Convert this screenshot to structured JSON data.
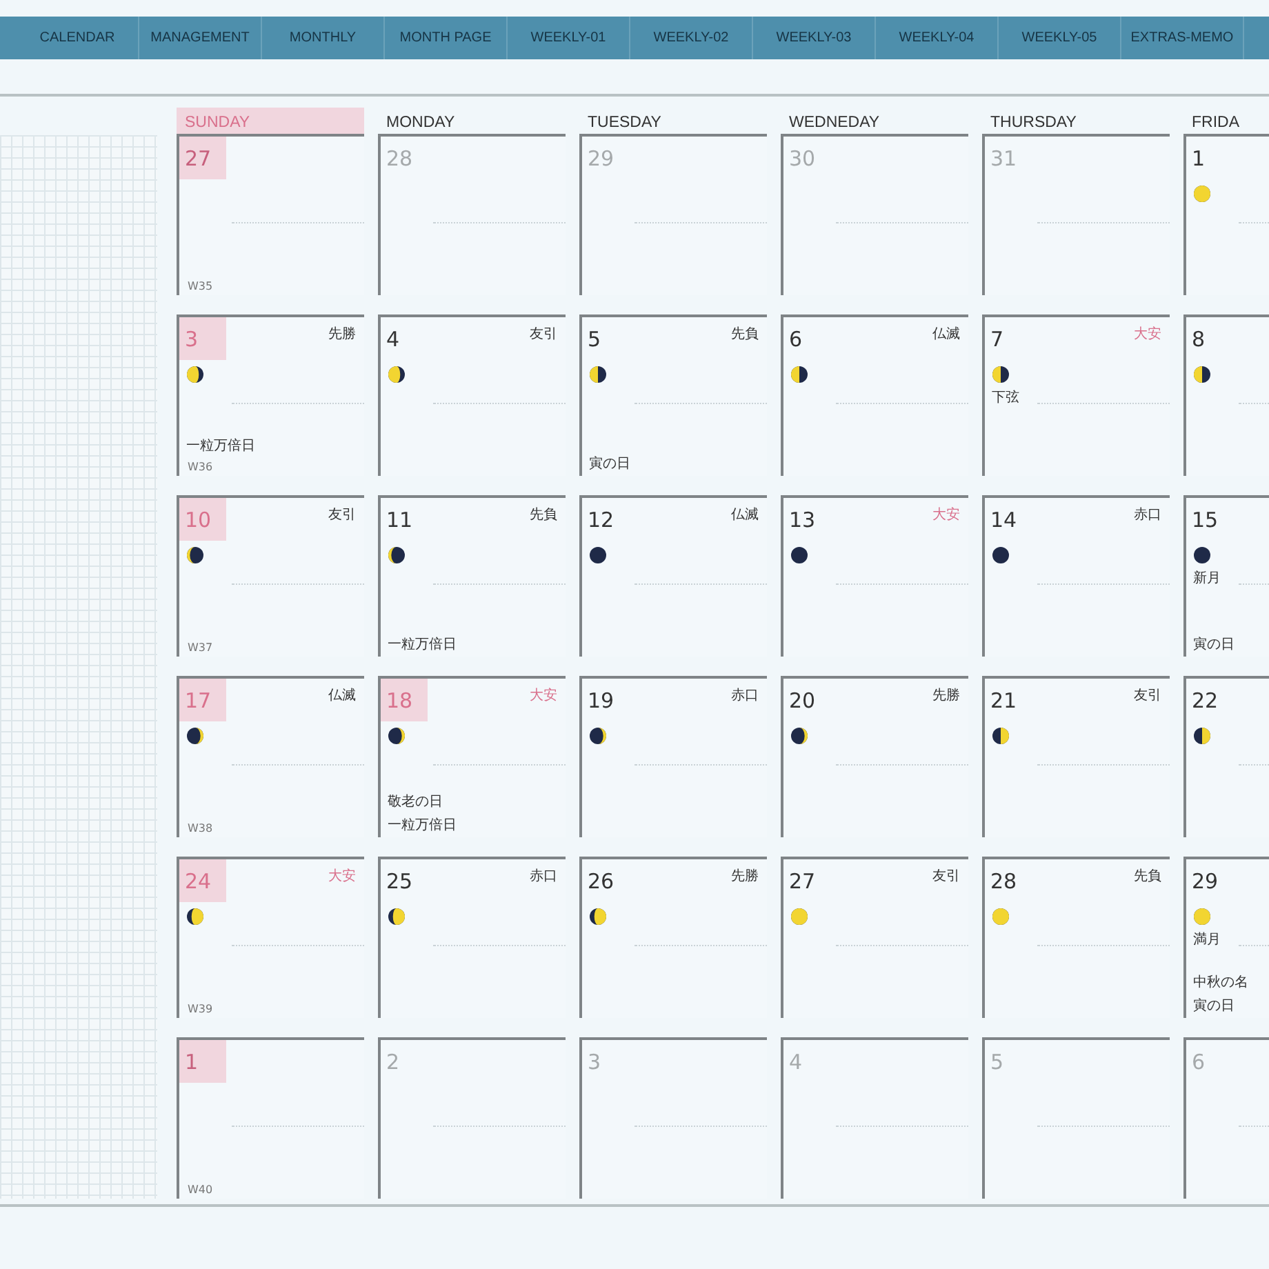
{
  "tabs": [
    {
      "label": "CALENDAR",
      "selected": false
    },
    {
      "label": "MANAGEMENT",
      "selected": false
    },
    {
      "label": "MONTHLY",
      "selected": false
    },
    {
      "label": "MONTH PAGE",
      "selected": false
    },
    {
      "label": "WEEKLY-01",
      "selected": false
    },
    {
      "label": "WEEKLY-02",
      "selected": false
    },
    {
      "label": "WEEKLY-03",
      "selected": false
    },
    {
      "label": "WEEKLY-04",
      "selected": false
    },
    {
      "label": "WEEKLY-05",
      "selected": false
    },
    {
      "label": "EXTRAS-MEMO",
      "selected": false
    }
  ],
  "weekdays": [
    {
      "label": "SUNDAY",
      "holiday": true
    },
    {
      "label": "MONDAY",
      "holiday": false
    },
    {
      "label": "TUESDAY",
      "holiday": false
    },
    {
      "label": "WEDNEDAY",
      "holiday": false
    },
    {
      "label": "THURSDAY",
      "holiday": false
    },
    {
      "label": "FRIDA",
      "holiday": false
    }
  ],
  "weeks": [
    {
      "week": "W35",
      "days": [
        {
          "number": "27",
          "other_month": true,
          "holiday": true
        },
        {
          "number": "28",
          "other_month": true,
          "holiday": false
        },
        {
          "number": "29",
          "other_month": true,
          "holiday": false
        },
        {
          "number": "30",
          "other_month": true,
          "holiday": false
        },
        {
          "number": "31",
          "other_month": true,
          "holiday": false
        },
        {
          "number": "1",
          "other_month": false,
          "holiday": false,
          "moon": {
            "kind": "full"
          }
        }
      ]
    },
    {
      "week": "W36",
      "days": [
        {
          "number": "3",
          "other_month": false,
          "holiday": true,
          "rokuyo": "先勝",
          "rokuyo_red": false,
          "moon": {
            "kind": "waning-gibbous"
          },
          "events": [
            "一粒万倍日"
          ]
        },
        {
          "number": "4",
          "other_month": false,
          "holiday": false,
          "rokuyo": "友引",
          "rokuyo_red": false,
          "moon": {
            "kind": "waning-gibbous"
          }
        },
        {
          "number": "5",
          "other_month": false,
          "holiday": false,
          "rokuyo": "先負",
          "rokuyo_red": false,
          "moon": {
            "kind": "last-quarter"
          },
          "events": [
            "寅の日"
          ]
        },
        {
          "number": "6",
          "other_month": false,
          "holiday": false,
          "rokuyo": "仏滅",
          "rokuyo_red": false,
          "moon": {
            "kind": "last-quarter"
          }
        },
        {
          "number": "7",
          "other_month": false,
          "holiday": false,
          "rokuyo": "大安",
          "rokuyo_red": true,
          "moon": {
            "kind": "last-quarter"
          },
          "phase": "下弦"
        },
        {
          "number": "8",
          "other_month": false,
          "holiday": false,
          "moon": {
            "kind": "last-quarter"
          }
        }
      ]
    },
    {
      "week": "W37",
      "days": [
        {
          "number": "10",
          "other_month": false,
          "holiday": true,
          "rokuyo": "友引",
          "rokuyo_red": false,
          "moon": {
            "kind": "waning-crescent"
          }
        },
        {
          "number": "11",
          "other_month": false,
          "holiday": false,
          "rokuyo": "先負",
          "rokuyo_red": false,
          "moon": {
            "kind": "waning-crescent"
          },
          "events": [
            "一粒万倍日"
          ]
        },
        {
          "number": "12",
          "other_month": false,
          "holiday": false,
          "rokuyo": "仏滅",
          "rokuyo_red": false,
          "moon": {
            "kind": "new"
          }
        },
        {
          "number": "13",
          "other_month": false,
          "holiday": false,
          "rokuyo": "大安",
          "rokuyo_red": true,
          "moon": {
            "kind": "new"
          }
        },
        {
          "number": "14",
          "other_month": false,
          "holiday": false,
          "rokuyo": "赤口",
          "rokuyo_red": false,
          "moon": {
            "kind": "new"
          }
        },
        {
          "number": "15",
          "other_month": false,
          "holiday": false,
          "moon": {
            "kind": "new"
          },
          "phase": "新月",
          "events": [
            "寅の日"
          ]
        }
      ]
    },
    {
      "week": "W38",
      "days": [
        {
          "number": "17",
          "other_month": false,
          "holiday": true,
          "rokuyo": "仏滅",
          "rokuyo_red": false,
          "moon": {
            "kind": "waxing-crescent"
          }
        },
        {
          "number": "18",
          "other_month": false,
          "holiday": true,
          "rokuyo": "大安",
          "rokuyo_red": true,
          "moon": {
            "kind": "waxing-crescent"
          },
          "events": [
            "敬老の日",
            "一粒万倍日"
          ]
        },
        {
          "number": "19",
          "other_month": false,
          "holiday": false,
          "rokuyo": "赤口",
          "rokuyo_red": false,
          "moon": {
            "kind": "waxing-crescent"
          }
        },
        {
          "number": "20",
          "other_month": false,
          "holiday": false,
          "rokuyo": "先勝",
          "rokuyo_red": false,
          "moon": {
            "kind": "waxing-crescent"
          }
        },
        {
          "number": "21",
          "other_month": false,
          "holiday": false,
          "rokuyo": "友引",
          "rokuyo_red": false,
          "moon": {
            "kind": "first-quarter"
          }
        },
        {
          "number": "22",
          "other_month": false,
          "holiday": false,
          "moon": {
            "kind": "first-quarter"
          }
        }
      ]
    },
    {
      "week": "W39",
      "days": [
        {
          "number": "24",
          "other_month": false,
          "holiday": true,
          "rokuyo": "大安",
          "rokuyo_red": true,
          "moon": {
            "kind": "waxing-gibbous"
          }
        },
        {
          "number": "25",
          "other_month": false,
          "holiday": false,
          "rokuyo": "赤口",
          "rokuyo_red": false,
          "moon": {
            "kind": "waxing-gibbous"
          }
        },
        {
          "number": "26",
          "other_month": false,
          "holiday": false,
          "rokuyo": "先勝",
          "rokuyo_red": false,
          "moon": {
            "kind": "waxing-gibbous"
          }
        },
        {
          "number": "27",
          "other_month": false,
          "holiday": false,
          "rokuyo": "友引",
          "rokuyo_red": false,
          "moon": {
            "kind": "full"
          }
        },
        {
          "number": "28",
          "other_month": false,
          "holiday": false,
          "rokuyo": "先負",
          "rokuyo_red": false,
          "moon": {
            "kind": "full"
          }
        },
        {
          "number": "29",
          "other_month": false,
          "holiday": false,
          "moon": {
            "kind": "full"
          },
          "phase": "満月",
          "events": [
            "中秋の名",
            "寅の日"
          ]
        }
      ]
    },
    {
      "week": "W40",
      "days": [
        {
          "number": "1",
          "other_month": true,
          "holiday": true
        },
        {
          "number": "2",
          "other_month": true,
          "holiday": false
        },
        {
          "number": "3",
          "other_month": true,
          "holiday": false
        },
        {
          "number": "4",
          "other_month": true,
          "holiday": false
        },
        {
          "number": "5",
          "other_month": true,
          "holiday": false
        },
        {
          "number": "6",
          "other_month": true,
          "holiday": false
        }
      ]
    }
  ]
}
